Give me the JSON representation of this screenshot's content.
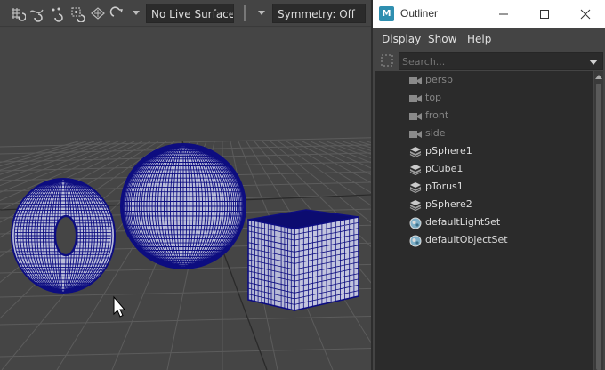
{
  "toolbar": {
    "icons": [
      "snap-to-grid-icon",
      "snap-to-curve-icon",
      "snap-to-point-icon",
      "snap-to-projected-center-icon",
      "snap-to-view-plane-icon",
      "snap-to-live-surface-icon"
    ],
    "live_surface": "No Live Surface",
    "symmetry": "Symmetry: Off"
  },
  "outliner": {
    "title": "Outliner",
    "app_icon": "M",
    "menu": {
      "display": "Display",
      "show": "Show",
      "help": "Help"
    },
    "search": {
      "placeholder": "Search..."
    },
    "items": [
      {
        "label": "persp",
        "icon": "camera-icon",
        "dim": true
      },
      {
        "label": "top",
        "icon": "camera-icon",
        "dim": true
      },
      {
        "label": "front",
        "icon": "camera-icon",
        "dim": true
      },
      {
        "label": "side",
        "icon": "camera-icon",
        "dim": true
      },
      {
        "label": "pSphere1",
        "icon": "mesh-transform-icon",
        "dim": false
      },
      {
        "label": "pCube1",
        "icon": "mesh-transform-icon",
        "dim": false
      },
      {
        "label": "pTorus1",
        "icon": "mesh-transform-icon",
        "dim": false
      },
      {
        "label": "pSphere2",
        "icon": "mesh-transform-icon",
        "dim": false
      },
      {
        "label": "defaultLightSet",
        "icon": "object-set-icon",
        "dim": false
      },
      {
        "label": "defaultObjectSet",
        "icon": "object-set-icon",
        "dim": false
      }
    ]
  },
  "viewport": {
    "wire_color": "#0d0d80",
    "grid_color": "#5c5c5c",
    "background": "#454545"
  }
}
